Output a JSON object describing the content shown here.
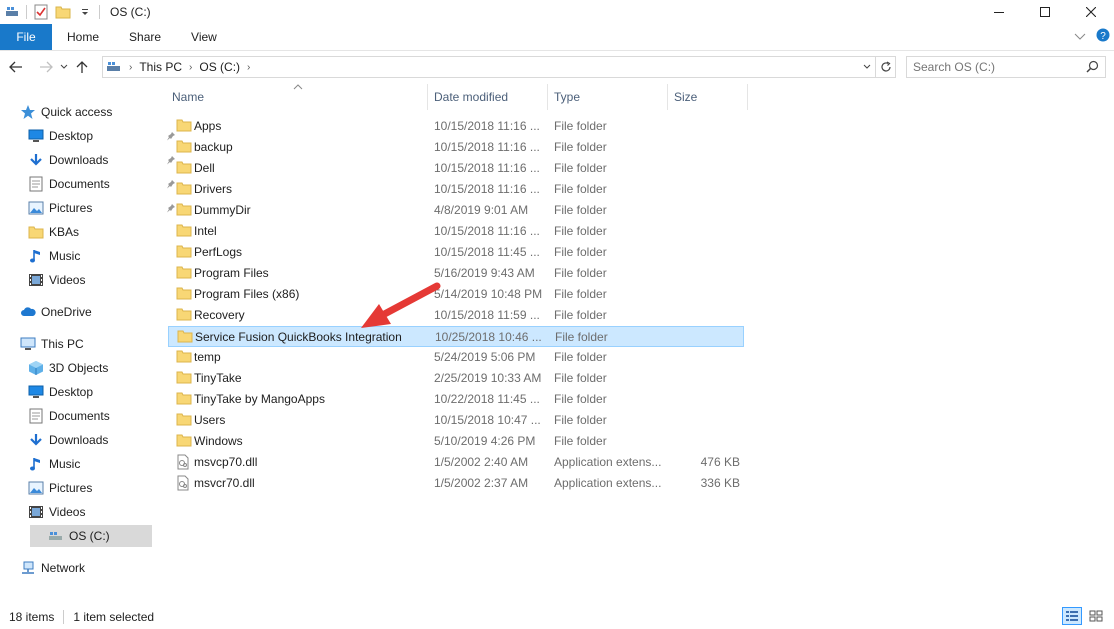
{
  "window": {
    "title": "OS (C:)",
    "minimize": "—",
    "maximize": "☐",
    "close": "✕"
  },
  "ribbon": {
    "tabs": [
      {
        "label": "File"
      },
      {
        "label": "Home"
      },
      {
        "label": "Share"
      },
      {
        "label": "View"
      }
    ]
  },
  "address": {
    "crumbs": [
      "This PC",
      "OS (C:)"
    ]
  },
  "search": {
    "placeholder": "Search OS (C:)"
  },
  "columns": {
    "name": "Name",
    "date": "Date modified",
    "type": "Type",
    "size": "Size"
  },
  "nav": {
    "quick_access": "Quick access",
    "qa_items": [
      {
        "label": "Desktop",
        "icon": "desktop-icon"
      },
      {
        "label": "Downloads",
        "icon": "downloads-icon"
      },
      {
        "label": "Documents",
        "icon": "documents-icon"
      },
      {
        "label": "Pictures",
        "icon": "pictures-icon"
      },
      {
        "label": "KBAs",
        "icon": "folder-icon"
      },
      {
        "label": "Music",
        "icon": "music-icon"
      },
      {
        "label": "Videos",
        "icon": "videos-icon"
      }
    ],
    "onedrive": "OneDrive",
    "this_pc": "This PC",
    "pc_items": [
      {
        "label": "3D Objects",
        "icon": "3d-objects-icon"
      },
      {
        "label": "Desktop",
        "icon": "desktop-icon"
      },
      {
        "label": "Documents",
        "icon": "documents-icon"
      },
      {
        "label": "Downloads",
        "icon": "downloads-icon"
      },
      {
        "label": "Music",
        "icon": "music-icon"
      },
      {
        "label": "Pictures",
        "icon": "pictures-icon"
      },
      {
        "label": "Videos",
        "icon": "videos-icon"
      },
      {
        "label": "OS (C:)",
        "icon": "drive-icon"
      }
    ],
    "network": "Network"
  },
  "files": [
    {
      "name": "Apps",
      "date": "10/15/2018 11:16 ...",
      "type": "File folder",
      "size": "",
      "kind": "folder"
    },
    {
      "name": "backup",
      "date": "10/15/2018 11:16 ...",
      "type": "File folder",
      "size": "",
      "kind": "folder"
    },
    {
      "name": "Dell",
      "date": "10/15/2018 11:16 ...",
      "type": "File folder",
      "size": "",
      "kind": "folder"
    },
    {
      "name": "Drivers",
      "date": "10/15/2018 11:16 ...",
      "type": "File folder",
      "size": "",
      "kind": "folder"
    },
    {
      "name": "DummyDir",
      "date": "4/8/2019 9:01 AM",
      "type": "File folder",
      "size": "",
      "kind": "folder"
    },
    {
      "name": "Intel",
      "date": "10/15/2018 11:16 ...",
      "type": "File folder",
      "size": "",
      "kind": "folder"
    },
    {
      "name": "PerfLogs",
      "date": "10/15/2018 11:45 ...",
      "type": "File folder",
      "size": "",
      "kind": "folder"
    },
    {
      "name": "Program Files",
      "date": "5/16/2019 9:43 AM",
      "type": "File folder",
      "size": "",
      "kind": "folder"
    },
    {
      "name": "Program Files (x86)",
      "date": "5/14/2019 10:48 PM",
      "type": "File folder",
      "size": "",
      "kind": "folder"
    },
    {
      "name": "Recovery",
      "date": "10/15/2018 11:59 ...",
      "type": "File folder",
      "size": "",
      "kind": "folder"
    },
    {
      "name": "Service Fusion QuickBooks Integration",
      "date": "10/25/2018 10:46 ...",
      "type": "File folder",
      "size": "",
      "kind": "folder",
      "selected": true
    },
    {
      "name": "temp",
      "date": "5/24/2019 5:06 PM",
      "type": "File folder",
      "size": "",
      "kind": "folder"
    },
    {
      "name": "TinyTake",
      "date": "2/25/2019 10:33 AM",
      "type": "File folder",
      "size": "",
      "kind": "folder"
    },
    {
      "name": "TinyTake by MangoApps",
      "date": "10/22/2018 11:45 ...",
      "type": "File folder",
      "size": "",
      "kind": "folder"
    },
    {
      "name": "Users",
      "date": "10/15/2018 10:47 ...",
      "type": "File folder",
      "size": "",
      "kind": "folder"
    },
    {
      "name": "Windows",
      "date": "5/10/2019 4:26 PM",
      "type": "File folder",
      "size": "",
      "kind": "folder"
    },
    {
      "name": "msvcp70.dll",
      "date": "1/5/2002 2:40 AM",
      "type": "Application extens...",
      "size": "476 KB",
      "kind": "dll"
    },
    {
      "name": "msvcr70.dll",
      "date": "1/5/2002 2:37 AM",
      "type": "Application extens...",
      "size": "336 KB",
      "kind": "dll"
    }
  ],
  "status": {
    "count": "18 items",
    "selection": "1 item selected"
  },
  "colors": {
    "accent": "#1979ca",
    "selection_bg": "#cce8ff",
    "selection_border": "#99d1ff",
    "folder": "#f8d775",
    "annotation": "#e53935"
  }
}
